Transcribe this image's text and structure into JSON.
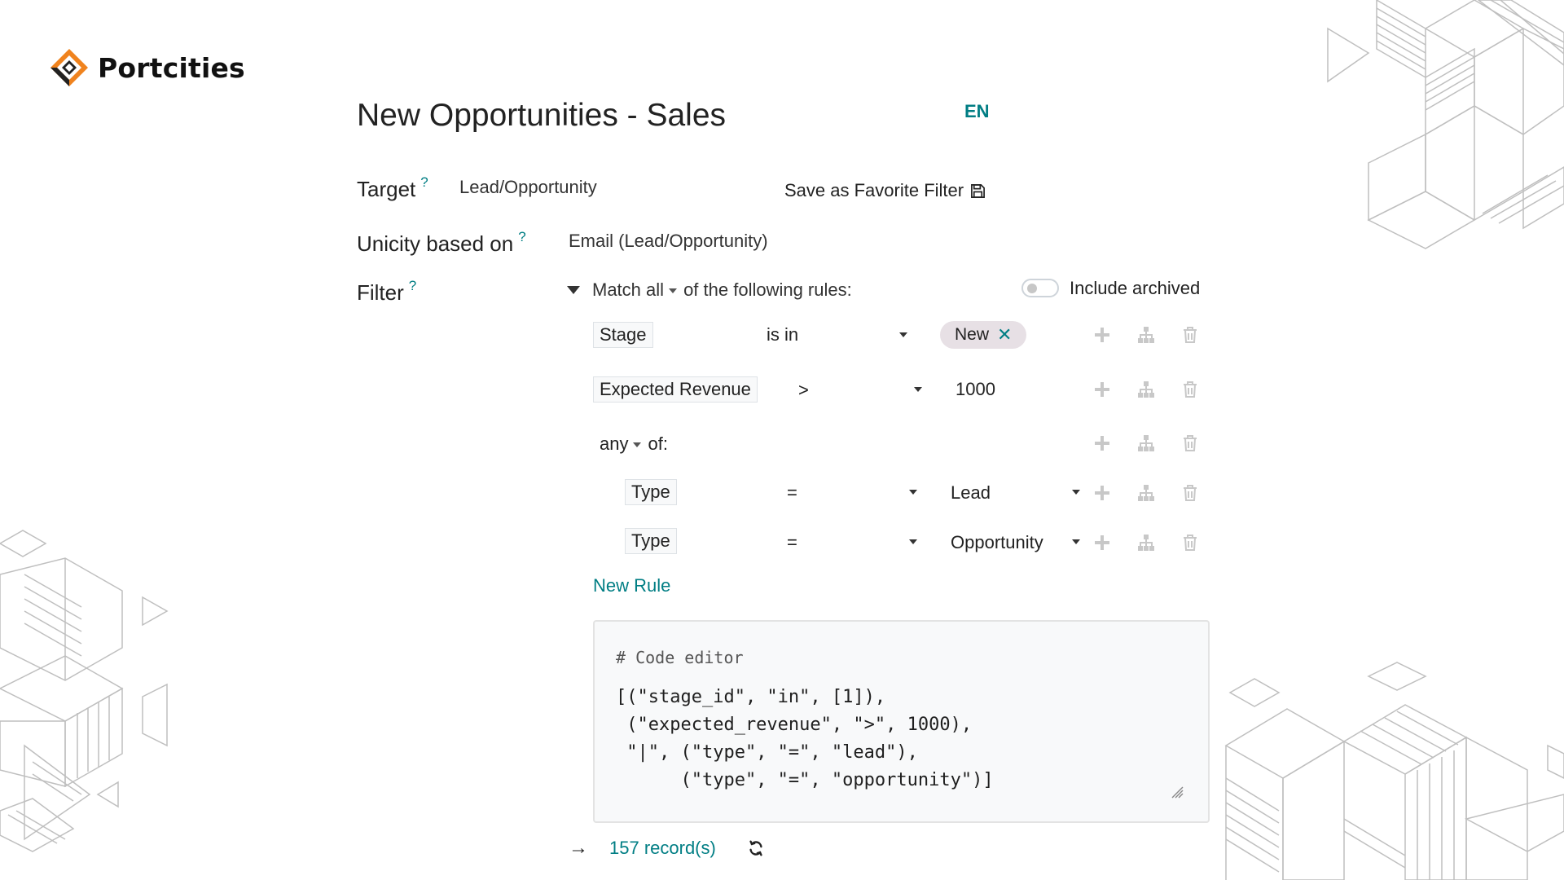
{
  "brand": {
    "name": "Portcities"
  },
  "header": {
    "title": "New Opportunities - Sales",
    "lang": "EN"
  },
  "target": {
    "label": "Target",
    "help": "?",
    "value": "Lead/Opportunity"
  },
  "favorite": {
    "label": "Save as Favorite Filter",
    "icon": "floppy-disk-icon"
  },
  "unicity": {
    "label": "Unicity based on",
    "help": "?",
    "value": "Email (Lead/Opportunity)"
  },
  "filter": {
    "label": "Filter",
    "help": "?",
    "match_prefix": "Match",
    "match_mode": "all",
    "match_suffix": "of the following rules:",
    "include_archived": {
      "label": "Include archived",
      "checked": false
    },
    "rules": [
      {
        "field": "Stage",
        "operator": "is in",
        "tag": "New"
      },
      {
        "field": "Expected Revenue",
        "operator": ">",
        "value": "1000"
      }
    ],
    "group": {
      "mode": "any",
      "suffix": "of:",
      "rules": [
        {
          "field": "Type",
          "operator": "=",
          "value": "Lead"
        },
        {
          "field": "Type",
          "operator": "=",
          "value": "Opportunity"
        }
      ]
    },
    "new_rule": "New Rule",
    "rule_actions": [
      "plus-icon",
      "sitemap-icon",
      "trash-icon"
    ]
  },
  "code_editor": {
    "comment": "# Code editor",
    "code": "[(\"stage_id\", \"in\", [1]),\n (\"expected_revenue\", \">\", 1000),\n \"|\", (\"type\", \"=\", \"lead\"),\n      (\"type\", \"=\", \"opportunity\")]"
  },
  "records": {
    "arrow": "→",
    "count": "157 record(s)"
  },
  "colors": {
    "accent": "#017e84",
    "brand_orange": "#f0831e",
    "tag_bg": "#e7e0e5",
    "icon_gray": "#c8c8c8"
  }
}
